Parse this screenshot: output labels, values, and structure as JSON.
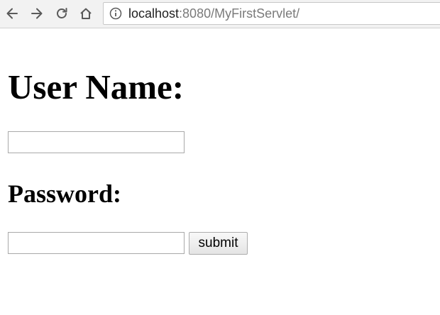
{
  "browser": {
    "back_icon": "arrow-left-icon",
    "forward_icon": "arrow-right-icon",
    "reload_icon": "reload-icon",
    "home_icon": "home-icon",
    "info_icon": "info-circle-icon",
    "url_host": "localhost",
    "url_path": ":8080/MyFirstServlet/"
  },
  "form": {
    "username_label": "User Name:",
    "username_value": "",
    "password_label": "Password:",
    "password_value": "",
    "submit_label": "submit"
  }
}
